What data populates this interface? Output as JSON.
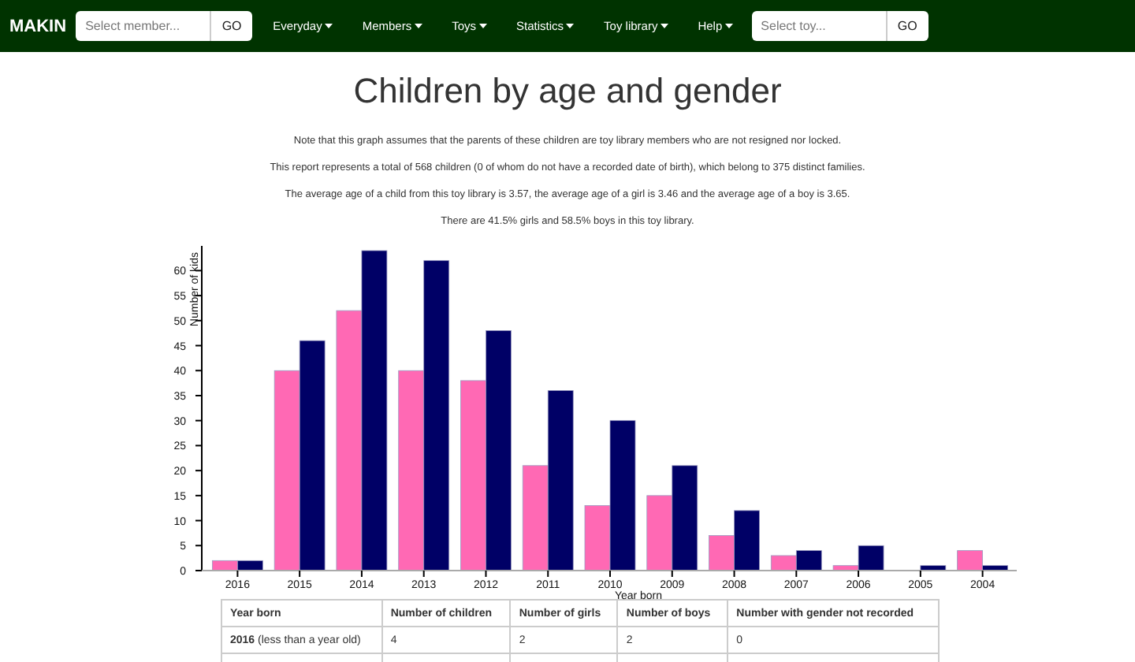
{
  "navbar": {
    "brand": "MAKIN",
    "member_search": {
      "placeholder": "Select member...",
      "button": "GO"
    },
    "menus": [
      {
        "label": "Everyday"
      },
      {
        "label": "Members"
      },
      {
        "label": "Toys"
      },
      {
        "label": "Statistics"
      },
      {
        "label": "Toy library"
      },
      {
        "label": "Help"
      }
    ],
    "toy_search": {
      "placeholder": "Select toy...",
      "button": "GO"
    }
  },
  "title": "Children by age and gender",
  "notes": [
    "Note that this graph assumes that the parents of these children are toy library members who are not resigned nor locked.",
    "This report represents a total of 568 children (0 of whom do not have a recorded date of birth), which belong to 375 distinct families.",
    "The average age of a child from this toy library is 3.57, the average age of a girl is 3.46 and the average age of a boy is 3.65.",
    "There are 41.5% girls and 58.5% boys in this toy library."
  ],
  "chart_data": {
    "type": "bar",
    "xlabel": "Year born",
    "ylabel": "Number of kids",
    "categories": [
      "2016",
      "2015",
      "2014",
      "2013",
      "2012",
      "2011",
      "2010",
      "2009",
      "2008",
      "2007",
      "2006",
      "2005",
      "2004"
    ],
    "series": [
      {
        "color": "#ff69b4",
        "values": [
          2,
          40,
          52,
          40,
          38,
          21,
          13,
          15,
          7,
          3,
          1,
          0,
          4
        ]
      },
      {
        "color": "#000066",
        "values": [
          2,
          46,
          64,
          62,
          48,
          36,
          30,
          21,
          12,
          4,
          5,
          1,
          1
        ]
      }
    ],
    "ylim": [
      0,
      64
    ],
    "yticks": [
      0,
      5,
      10,
      15,
      20,
      25,
      30,
      35,
      40,
      45,
      50,
      55,
      60
    ]
  },
  "table": {
    "columns": [
      "Year born",
      "Number of children",
      "Number of girls",
      "Number of boys",
      "Number with gender not recorded"
    ],
    "rows": [
      [
        "**2016** (less than a year old)",
        "4",
        "2",
        "2",
        "0"
      ]
    ]
  }
}
